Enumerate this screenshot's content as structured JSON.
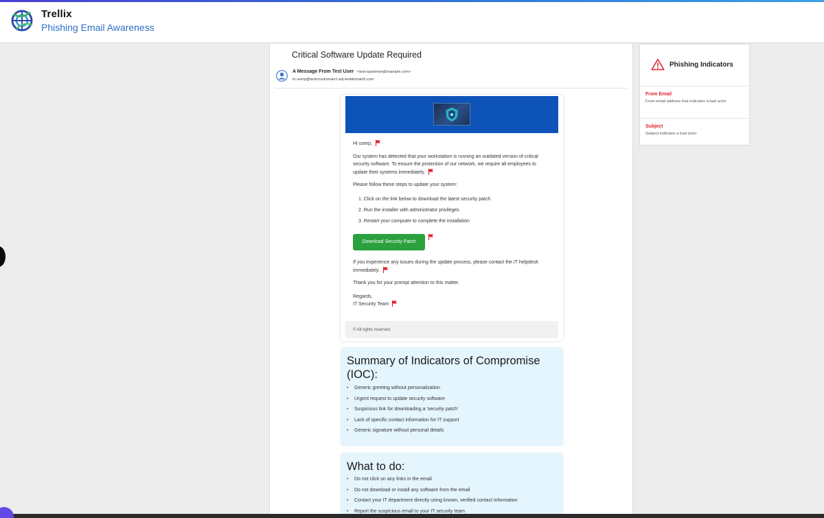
{
  "header": {
    "brand": "Trellix",
    "app_name": "Phishing Email Awareness",
    "logo_icon": "trellix-globe-logo",
    "accent_color": "#2d6ec8"
  },
  "email": {
    "subject": "Critical Software Update Required",
    "sender_name": "A Message From Test User",
    "sender_email": "<test-spammer@example.com>",
    "recipient": "to userp@testcmsdomain1.etp-testdomain5.com",
    "body": {
      "greeting": "Hi userp,",
      "paragraph1": "Our system has detected that your workstation is running an outdated version of critical security software. To ensure the protection of our network, we require all employees to update their systems immediately.",
      "paragraph2": "Please follow these steps to update your system:",
      "steps": [
        "1. Click on the link below to download the latest security patch",
        "2. Run the installer with administrator privileges",
        "3. Restart your computer to complete the installation"
      ],
      "button_label": "Download Security Patch",
      "paragraph3": "If you experience any issues during the update process, please contact the IT helpdesk immediately.",
      "paragraph4": "Thank you for your prompt attention to this matter.",
      "closing": "Regards,",
      "signature": "IT Security Team"
    },
    "footer": "© All rights reserved.",
    "banner_color": "#0e53b8",
    "button_color": "#2aa13d",
    "flag_icon": "red-flag-icon"
  },
  "ioc_summary": {
    "title": "Summary of Indicators of Compromise (IOC):",
    "items": [
      "Generic greeting without personalization",
      "Urgent request to update security software",
      "Suspicious link for downloading a 'security patch'",
      "Lack of specific contact information for IT support",
      "Generic signature without personal details"
    ]
  },
  "what_to_do": {
    "title": "What to do:",
    "items": [
      "Do not click on any links in the email",
      "Do not download or install any software from the email",
      "Contact your IT department directly using known, verified contact information",
      "Report the suspicious email to your IT security team"
    ]
  },
  "indicators_panel": {
    "title": "Phishing Indicators",
    "icon": "warning-triangle-icon",
    "items": [
      {
        "title": "From Email",
        "description": "From email address that indicates a bad actor"
      },
      {
        "title": "Subject",
        "description": "Subject indicates a bad actor"
      }
    ],
    "highlight_color": "#e0232f"
  }
}
